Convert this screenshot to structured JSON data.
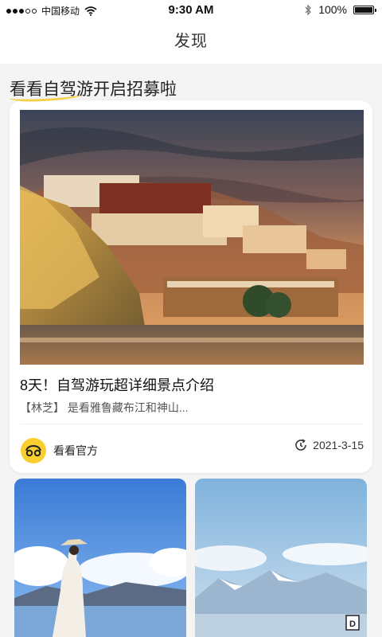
{
  "status_bar": {
    "carrier": "中国移动",
    "time": "9:30 AM",
    "battery": "100%",
    "battery_level": 1.0,
    "signal_bars": 3
  },
  "nav": {
    "title": "发现"
  },
  "section": {
    "title": "看看自驾游开启招募啦"
  },
  "feature": {
    "title": "8天！自驾游玩超详细景点介绍",
    "desc": "【林芝】 是看雅鲁藏布江和神山...",
    "author": "看看官方",
    "date": "2021-3-15"
  },
  "colors": {
    "accent": "#f6cf45",
    "avatar": "#f8cf2f"
  },
  "icons": {
    "bluetooth": "bluetooth-icon",
    "wifi": "wifi-icon",
    "date": "refresh-clock-icon"
  }
}
